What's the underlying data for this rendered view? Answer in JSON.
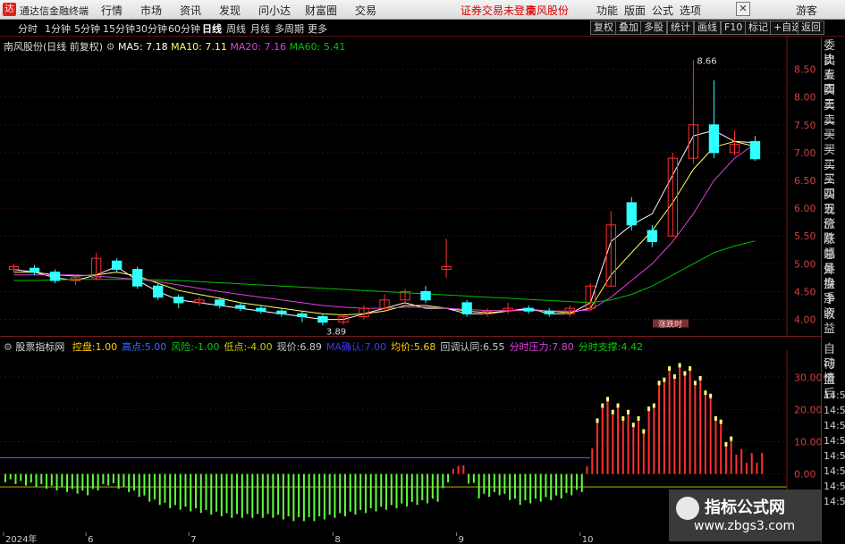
{
  "menu": {
    "app_title": "通达信金融终端",
    "items": [
      "行情",
      "市场",
      "资讯",
      "发现",
      "问小达",
      "财富圈",
      "交易"
    ],
    "login_notice": "证券交易未登录",
    "stock_name": "南风股份",
    "right_items": [
      "功能",
      "版面",
      "公式",
      "选项"
    ],
    "close": "✕",
    "guest": "游客"
  },
  "periods": [
    "分时",
    "1分钟",
    "5分钟",
    "15分钟",
    "30分钟",
    "60分钟",
    "日线",
    "周线",
    "月线",
    "多周期",
    "更多"
  ],
  "selected_period": "日线",
  "toolbar_right": [
    "复权",
    "叠加",
    "多股",
    "统计",
    "画线",
    "F10",
    "标记",
    "+自选",
    "返回"
  ],
  "main_header": {
    "title": "南风股份(日线 前复权)",
    "ma5": "MA5: 7.18",
    "ma10": "MA10: 7.11",
    "ma20": "MA20: 7.16",
    "ma60": "MA60: 5.41"
  },
  "annotations": {
    "high": "8.66",
    "low": "3.89",
    "badge": "涨跌时"
  },
  "indicator_header": {
    "name": "股票指标网",
    "fields": [
      {
        "label": "控盘:",
        "value": "1.00",
        "color": "#ffd000"
      },
      {
        "label": "高点:",
        "value": "5.00",
        "color": "#3a6bff"
      },
      {
        "label": "风险:",
        "value": "-1.00",
        "color": "#00d000"
      },
      {
        "label": "低点:",
        "value": "-4.00",
        "color": "#d0d000"
      },
      {
        "label": "现价:",
        "value": "6.89",
        "color": "#cccccc"
      },
      {
        "label": "MA确认:",
        "value": "7.00",
        "color": "#3a3aff"
      },
      {
        "label": "均价:",
        "value": "5.68",
        "color": "#ffd000"
      },
      {
        "label": "回调认同:",
        "value": "6.55",
        "color": "#cccccc"
      },
      {
        "label": "分时压力:",
        "value": "7.80",
        "color": "#e040e0"
      },
      {
        "label": "分时支撑:",
        "value": "4.42",
        "color": "#00d000"
      }
    ]
  },
  "price_axis": [
    "8.50",
    "8.00",
    "7.50",
    "7.00",
    "6.50",
    "6.00",
    "5.50",
    "5.00",
    "4.50",
    "4.00"
  ],
  "indicator_axis": [
    "30.00",
    "20.00",
    "10.00",
    "0.00"
  ],
  "date_axis": [
    "2024年",
    "6",
    "7",
    "8",
    "9",
    "10"
  ],
  "right_list_top": [
    "委比",
    "卖五",
    "卖四",
    "卖三",
    "卖二",
    "卖一",
    "买一",
    "买二",
    "买三",
    "买四",
    "买五",
    "现价",
    "涨跌",
    "涨幅",
    "总量",
    "外盘",
    "换手",
    "净资",
    "收益"
  ],
  "right_list_bottom": [
    "自动",
    "行情",
    "盘后",
    "14:50",
    "14:50",
    "14:50",
    "14:50",
    "14:50",
    "14:50",
    "14:50",
    "14:50"
  ],
  "watermark": {
    "title": "指标公式网",
    "url": "www.zbgs3.com"
  },
  "colors": {
    "up": "#ff3030",
    "down": "#30ffff",
    "ma5": "#ffffff",
    "ma10": "#ffff60",
    "ma20": "#e040e0",
    "ma60": "#00c000"
  },
  "chart_data": [
    {
      "type": "candlestick",
      "ylim": [
        3.8,
        8.75
      ],
      "series": [
        {
          "name": "MA5",
          "values": [
            4.9,
            4.85,
            4.75,
            4.7,
            4.8,
            4.95,
            4.7,
            4.5,
            4.35,
            4.3,
            4.25,
            4.2,
            4.15,
            4.1,
            4.05,
            4.0,
            4.0,
            4.1,
            4.2,
            4.3,
            4.2,
            4.2,
            4.1,
            4.1,
            4.15,
            4.2,
            4.1,
            4.1,
            4.3,
            5.4,
            5.7,
            5.9,
            6.6,
            7.3,
            7.4,
            7.2,
            7.18
          ]
        },
        {
          "name": "MA10",
          "values": [
            4.85,
            4.85,
            4.8,
            4.78,
            4.8,
            4.85,
            4.78,
            4.65,
            4.52,
            4.45,
            4.38,
            4.3,
            4.25,
            4.2,
            4.15,
            4.1,
            4.08,
            4.1,
            4.15,
            4.25,
            4.25,
            4.2,
            4.15,
            4.12,
            4.15,
            4.18,
            4.15,
            4.12,
            4.2,
            4.8,
            5.2,
            5.6,
            6.1,
            6.7,
            7.1,
            7.2,
            7.11
          ]
        },
        {
          "name": "MA20",
          "values": [
            4.8,
            4.8,
            4.8,
            4.8,
            4.78,
            4.75,
            4.72,
            4.68,
            4.62,
            4.56,
            4.5,
            4.45,
            4.4,
            4.35,
            4.3,
            4.25,
            4.22,
            4.2,
            4.2,
            4.22,
            4.22,
            4.2,
            4.18,
            4.16,
            4.16,
            4.16,
            4.15,
            4.15,
            4.17,
            4.4,
            4.7,
            5.0,
            5.4,
            5.9,
            6.5,
            6.9,
            7.16
          ]
        },
        {
          "name": "MA60",
          "values": [
            4.7,
            4.7,
            4.71,
            4.72,
            4.72,
            4.72,
            4.72,
            4.71,
            4.7,
            4.68,
            4.66,
            4.64,
            4.62,
            4.6,
            4.58,
            4.56,
            4.54,
            4.52,
            4.5,
            4.48,
            4.46,
            4.44,
            4.42,
            4.4,
            4.38,
            4.36,
            4.34,
            4.32,
            4.3,
            4.35,
            4.45,
            4.6,
            4.8,
            5.0,
            5.2,
            5.32,
            5.41
          ]
        }
      ],
      "candles": [
        [
          4.9,
          4.95,
          4.85,
          5.0
        ],
        [
          4.92,
          4.85,
          4.8,
          4.98
        ],
        [
          4.85,
          4.7,
          4.65,
          4.9
        ],
        [
          4.7,
          4.75,
          4.62,
          4.8
        ],
        [
          4.75,
          5.1,
          4.7,
          5.2
        ],
        [
          5.05,
          4.9,
          4.85,
          5.1
        ],
        [
          4.9,
          4.6,
          4.55,
          4.95
        ],
        [
          4.6,
          4.4,
          4.35,
          4.65
        ],
        [
          4.4,
          4.3,
          4.2,
          4.45
        ],
        [
          4.3,
          4.35,
          4.25,
          4.4
        ],
        [
          4.35,
          4.25,
          4.2,
          4.4
        ],
        [
          4.25,
          4.2,
          4.15,
          4.3
        ],
        [
          4.2,
          4.15,
          4.1,
          4.25
        ],
        [
          4.15,
          4.1,
          4.05,
          4.2
        ],
        [
          4.1,
          4.05,
          3.95,
          4.15
        ],
        [
          4.05,
          3.95,
          3.89,
          4.1
        ],
        [
          3.95,
          4.05,
          3.9,
          4.1
        ],
        [
          4.05,
          4.2,
          4.0,
          4.25
        ],
        [
          4.2,
          4.35,
          4.15,
          4.45
        ],
        [
          4.35,
          4.5,
          4.3,
          4.55
        ],
        [
          4.5,
          4.35,
          4.3,
          4.6
        ],
        [
          4.9,
          4.95,
          4.75,
          5.45
        ],
        [
          4.3,
          4.1,
          4.05,
          4.35
        ],
        [
          4.1,
          4.15,
          4.05,
          4.2
        ],
        [
          4.15,
          4.2,
          4.1,
          4.3
        ],
        [
          4.2,
          4.15,
          4.1,
          4.25
        ],
        [
          4.15,
          4.1,
          4.05,
          4.2
        ],
        [
          4.1,
          4.2,
          4.05,
          4.25
        ],
        [
          4.2,
          4.6,
          4.2,
          4.65
        ],
        [
          4.6,
          5.7,
          4.6,
          5.95
        ],
        [
          6.1,
          5.7,
          5.6,
          6.2
        ],
        [
          5.6,
          5.4,
          5.3,
          5.7
        ],
        [
          5.5,
          6.9,
          5.5,
          7.0
        ],
        [
          6.9,
          7.5,
          6.8,
          8.66
        ],
        [
          7.5,
          7.0,
          6.9,
          8.3
        ],
        [
          7.0,
          7.15,
          6.95,
          7.4
        ],
        [
          7.2,
          6.89,
          6.85,
          7.3
        ]
      ]
    },
    {
      "type": "bar",
      "ylim": [
        -17,
        37
      ],
      "series": [
        {
          "name": "控盘",
          "values": [
            -2,
            -3,
            -4,
            -5,
            -6,
            -3,
            -5,
            -8,
            -10,
            -11,
            -12,
            -13,
            -13,
            -13,
            -14,
            -14,
            -13,
            -12,
            -11,
            -10,
            -9,
            -8,
            4,
            -7,
            -6,
            -9,
            -8,
            -7,
            -5,
            22,
            18,
            14,
            30,
            32,
            26,
            10,
            5
          ]
        }
      ]
    }
  ]
}
